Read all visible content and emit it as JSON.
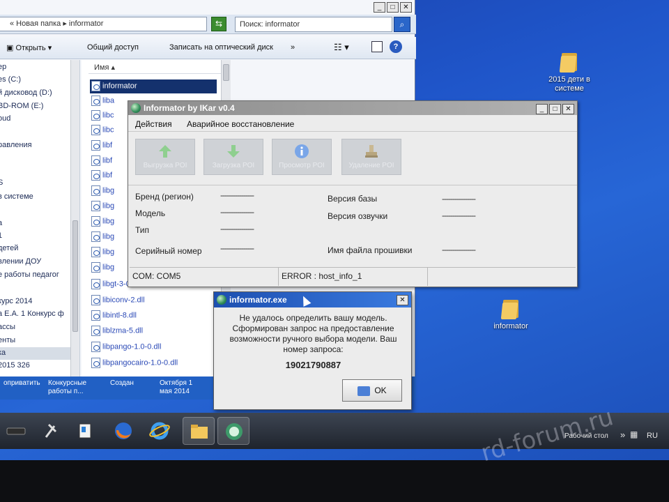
{
  "desktop": {
    "icons": [
      {
        "label": "2015 дети в системе"
      },
      {
        "label": "informator"
      }
    ]
  },
  "explorer": {
    "breadcrumb": "« Новая папка ▸ informator",
    "search_placeholder": "Поиск: informator",
    "toolbar": {
      "open": "Открыть",
      "share": "Общий доступ",
      "burn": "Записать на оптический диск",
      "more": "»"
    },
    "nav_items": [
      "ер",
      "es (C:)",
      "й дисковод (D:)",
      "BD-ROM (E:)",
      "oud",
      "равления",
      "S",
      "в системе",
      "а",
      "1",
      "детей",
      "влении ДОУ",
      "е работы педагог",
      "курс 2014",
      "а Е.А. 1 Конкурс ф",
      "ассы",
      "енты",
      "2015 326",
      "ка"
    ],
    "column_header": "Имя",
    "files": [
      "informator",
      "liba",
      "libc",
      "libc",
      "libf",
      "libf",
      "libf",
      "libg",
      "libg",
      "libg",
      "libg",
      "libg",
      "libg",
      "libgt",
      "libgt-3-0.dll",
      "libiconv-2.dll",
      "libintl-8.dll",
      "liblzma-5.dll",
      "libpango-1.0-0.dll",
      "libpangocairo-1.0-0.dll"
    ],
    "status": {
      "col1": "оприватить",
      "col2": "Конкурсные работы п...",
      "col3": "Создан",
      "col4": "Октября 1 мая 2014"
    }
  },
  "informator": {
    "title": "Informator by IKar v0.4",
    "menu": [
      "Действия",
      "Аварийное восстановление"
    ],
    "buttons": [
      "Выгрузка POI",
      "Загрузка POI",
      "Просмотр POI",
      "Удаление POI"
    ],
    "fields_left": [
      "Бренд (регион)",
      "Модель",
      "Тип",
      "Серийный номер"
    ],
    "fields_right": [
      "Версия базы",
      "Версия озвучки",
      "Имя файла прошивки"
    ],
    "placeholder_value": "----------------",
    "status": {
      "port": "COM: COM5",
      "error": "ERROR : host_info_1"
    }
  },
  "dialog": {
    "title": "informator.exe",
    "message": "Не удалось определить вашу модель. Сформирован запрос на предоставление возможности ручного выбора модели. Ваш номер запроса:",
    "request_number": "19021790887",
    "ok_label": "OK"
  },
  "taskbar": {
    "tray_label": "Рабочий стол",
    "lang": "RU"
  },
  "watermark": "rd-forum.ru",
  "colors": {
    "desktop": "#1f55c9",
    "dialog_title": "#1d4fb0",
    "informator_title": "#8c8c8c",
    "taskbar": "#2a303a"
  }
}
